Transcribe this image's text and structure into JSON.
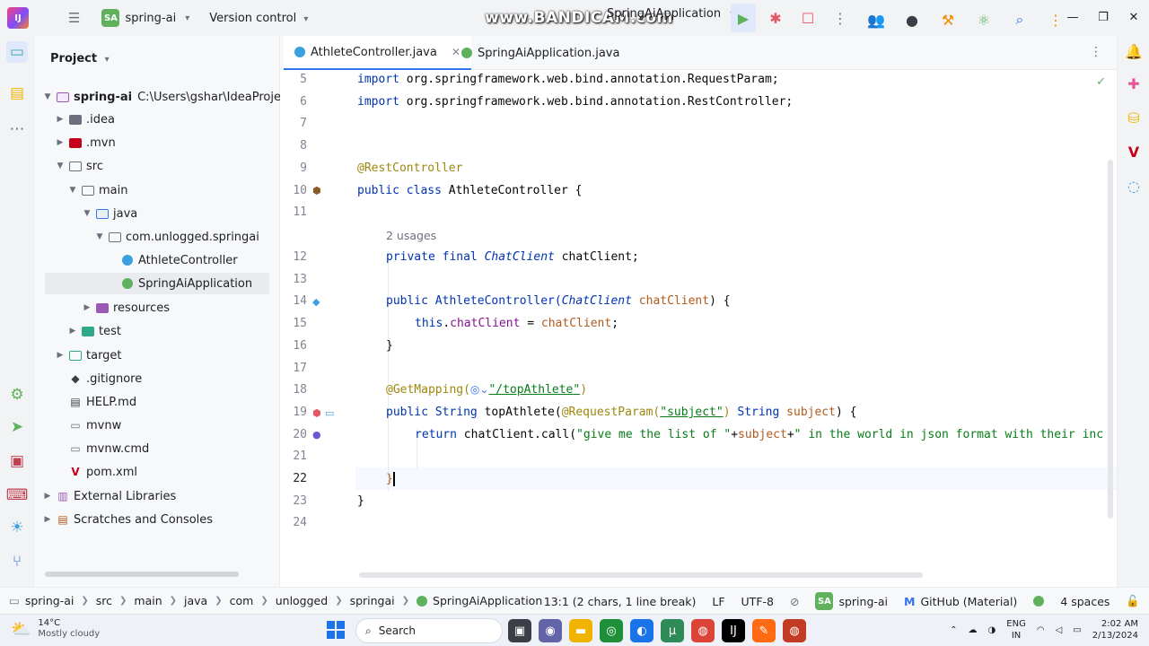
{
  "titlebar": {
    "project_badge": "SA",
    "project_name": "spring-ai",
    "vcs_label": "Version control",
    "watermark": "www.BANDICAM.com",
    "run_config": "SpringAiApplication"
  },
  "project_panel": {
    "title": "Project",
    "tree": [
      {
        "label": "spring-ai",
        "extra": "C:\\Users\\gshar\\IdeaProjects\\s",
        "icon": "module-folder"
      },
      {
        "label": ".idea",
        "icon": "folder"
      },
      {
        "label": ".mvn",
        "icon": "folder"
      },
      {
        "label": "src",
        "icon": "folder"
      },
      {
        "label": "main",
        "icon": "folder"
      },
      {
        "label": "java",
        "icon": "source-folder"
      },
      {
        "label": "com.unlogged.springai",
        "icon": "package"
      },
      {
        "label": "AthleteController",
        "icon": "class"
      },
      {
        "label": "SpringAiApplication",
        "icon": "spring-class"
      },
      {
        "label": "resources",
        "icon": "resources-folder"
      },
      {
        "label": "test",
        "icon": "test-folder"
      },
      {
        "label": "target",
        "icon": "excluded-folder"
      },
      {
        "label": ".gitignore",
        "icon": "gitignore"
      },
      {
        "label": "HELP.md",
        "icon": "markdown"
      },
      {
        "label": "mvnw",
        "icon": "file"
      },
      {
        "label": "mvnw.cmd",
        "icon": "file"
      },
      {
        "label": "pom.xml",
        "icon": "maven"
      },
      {
        "label": "External Libraries",
        "icon": "libraries"
      },
      {
        "label": "Scratches and Consoles",
        "icon": "scratches"
      }
    ]
  },
  "tabs": [
    {
      "label": "AthleteController.java",
      "active": true
    },
    {
      "label": "SpringAiApplication.java",
      "active": false
    }
  ],
  "editor": {
    "line_numbers": [
      "5",
      "6",
      "7",
      "8",
      "9",
      "10",
      "11",
      "12",
      "13",
      "14",
      "15",
      "16",
      "17",
      "18",
      "19",
      "20",
      "21",
      "22",
      "23",
      "24"
    ],
    "current_line": "22",
    "usages_hint": "2 usages",
    "code": {
      "l5_kw": "import",
      "l5_rest": " org.springframework.web.bind.annotation.RequestParam;",
      "l6_kw": "import",
      "l6_rest": " org.springframework.web.bind.annotation.RestController;",
      "l9_ann": "@RestController",
      "l10_kw": "public class",
      "l10_name": " AthleteController ",
      "l10_brace": "{",
      "l12_kw": "private final",
      "l12_type": " ChatClient",
      "l12_rest": " chatClient;",
      "l14_kw": "public",
      "l14_name": " AthleteController(",
      "l14_type": "ChatClient",
      "l14_param": " chatClient",
      "l14_rest": ") {",
      "l15_kw": "this",
      "l15_dot": ".",
      "l15_field": "chatClient",
      "l15_eq": " = ",
      "l15_param": "chatClient",
      "l15_end": ";",
      "l16": "}",
      "l18_ann": "@GetMapping(",
      "l18_str": "\"/topAthlete\"",
      "l18_end": ")",
      "l19_kw": "public",
      "l19_type": " String",
      "l19_name": " topAthlete(",
      "l19_ann": "@RequestParam(",
      "l19_str": "\"subject\"",
      "l19_mid": ")",
      "l19_type2": " String",
      "l19_param": " subject",
      "l19_end": ") {",
      "l20_kw": "return",
      "l20_call": " chatClient.call(",
      "l20_str1": "\"give me the list of \"",
      "l20_op1": "+",
      "l20_param": "subject",
      "l20_op2": "+",
      "l20_str2": "\" in the world in json format with their inc",
      "l22": "}",
      "l23": "}"
    }
  },
  "statusbar": {
    "breadcrumbs": [
      "spring-ai",
      "src",
      "main",
      "java",
      "com",
      "unlogged",
      "springai",
      "SpringAiApplication"
    ],
    "position": "13:1 (2 chars, 1 line break)",
    "line_separator": "LF",
    "encoding": "UTF-8",
    "project_badge": "SA",
    "project": "spring-ai",
    "theme": "GitHub (Material)",
    "indent": "4 spaces"
  },
  "taskbar": {
    "temperature": "14°C",
    "weather": "Mostly cloudy",
    "search_placeholder": "Search",
    "lang_line1": "ENG",
    "lang_line2": "IN",
    "time": "2:02 AM",
    "date": "2/13/2024"
  },
  "colors": {
    "accent": "#3574f0",
    "keyword": "#0033b3",
    "annotation": "#9e880d",
    "string": "#067d17",
    "field": "#871094",
    "parameter": "#b05a1b"
  }
}
